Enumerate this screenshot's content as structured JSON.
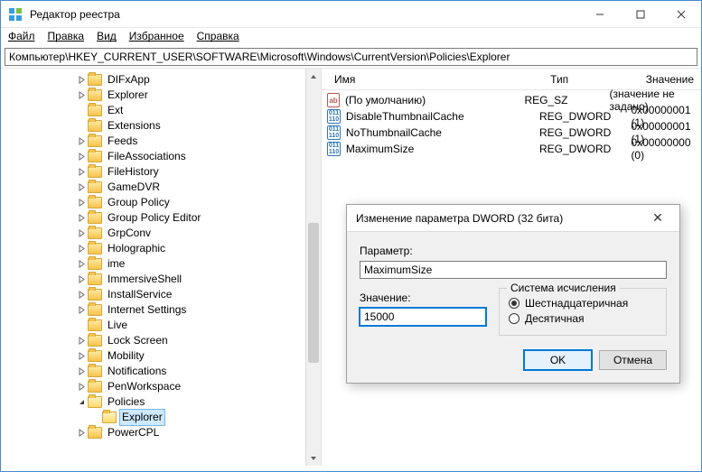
{
  "window": {
    "title": "Редактор реестра"
  },
  "menu": {
    "file": "Файл",
    "edit": "Правка",
    "view": "Вид",
    "favorites": "Избранное",
    "help": "Справка"
  },
  "address": "Компьютер\\HKEY_CURRENT_USER\\SOFTWARE\\Microsoft\\Windows\\CurrentVersion\\Policies\\Explorer",
  "tree": [
    {
      "depth": 4,
      "expand": "closed",
      "name": "DIFxApp"
    },
    {
      "depth": 4,
      "expand": "closed",
      "name": "Explorer"
    },
    {
      "depth": 4,
      "expand": "none",
      "name": "Ext"
    },
    {
      "depth": 4,
      "expand": "none",
      "name": "Extensions"
    },
    {
      "depth": 4,
      "expand": "closed",
      "name": "Feeds"
    },
    {
      "depth": 4,
      "expand": "closed",
      "name": "FileAssociations"
    },
    {
      "depth": 4,
      "expand": "closed",
      "name": "FileHistory"
    },
    {
      "depth": 4,
      "expand": "closed",
      "name": "GameDVR"
    },
    {
      "depth": 4,
      "expand": "closed",
      "name": "Group Policy"
    },
    {
      "depth": 4,
      "expand": "closed",
      "name": "Group Policy Editor"
    },
    {
      "depth": 4,
      "expand": "closed",
      "name": "GrpConv"
    },
    {
      "depth": 4,
      "expand": "closed",
      "name": "Holographic"
    },
    {
      "depth": 4,
      "expand": "closed",
      "name": "ime"
    },
    {
      "depth": 4,
      "expand": "closed",
      "name": "ImmersiveShell"
    },
    {
      "depth": 4,
      "expand": "closed",
      "name": "InstallService"
    },
    {
      "depth": 4,
      "expand": "closed",
      "name": "Internet Settings"
    },
    {
      "depth": 4,
      "expand": "none",
      "name": "Live"
    },
    {
      "depth": 4,
      "expand": "closed",
      "name": "Lock Screen"
    },
    {
      "depth": 4,
      "expand": "closed",
      "name": "Mobility"
    },
    {
      "depth": 4,
      "expand": "closed",
      "name": "Notifications"
    },
    {
      "depth": 4,
      "expand": "closed",
      "name": "PenWorkspace"
    },
    {
      "depth": 4,
      "expand": "open",
      "name": "Policies"
    },
    {
      "depth": 5,
      "expand": "none",
      "name": "Explorer",
      "selected": true
    },
    {
      "depth": 4,
      "expand": "closed",
      "name": "PowerCPL"
    }
  ],
  "list": {
    "cols": {
      "name": "Имя",
      "type": "Тип",
      "value": "Значение"
    },
    "rows": [
      {
        "kind": "sz",
        "name": "(По умолчанию)",
        "type": "REG_SZ",
        "value": "(значение не задано)"
      },
      {
        "kind": "dw",
        "name": "DisableThumbnailCache",
        "type": "REG_DWORD",
        "value": "0x00000001 (1)"
      },
      {
        "kind": "dw",
        "name": "NoThumbnailCache",
        "type": "REG_DWORD",
        "value": "0x00000001 (1)"
      },
      {
        "kind": "dw",
        "name": "MaximumSize",
        "type": "REG_DWORD",
        "value": "0x00000000 (0)"
      }
    ]
  },
  "dialog": {
    "title": "Изменение параметра DWORD (32 бита)",
    "param_label": "Параметр:",
    "param_value": "MaximumSize",
    "value_label": "Значение:",
    "value_value": "15000",
    "base_label": "Система исчисления",
    "radio_hex": "Шестнадцатеричная",
    "radio_dec": "Десятичная",
    "radio_selected": "hex",
    "ok": "OK",
    "cancel": "Отмена"
  }
}
